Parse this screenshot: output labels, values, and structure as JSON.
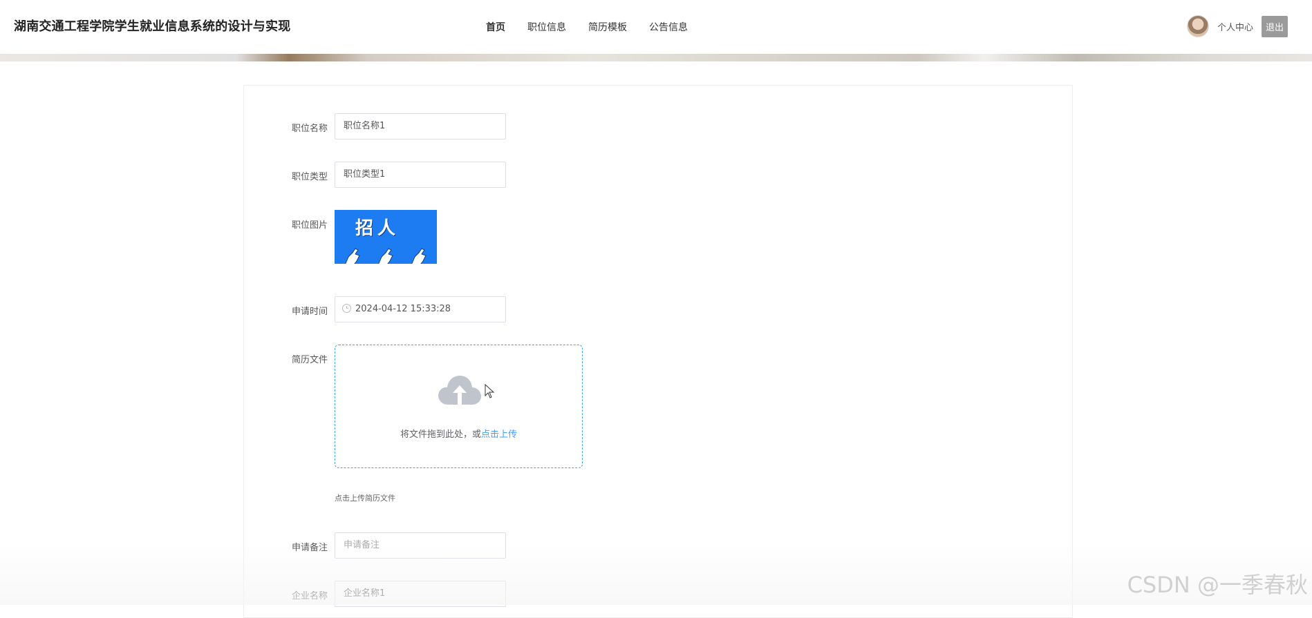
{
  "header": {
    "site_title": "湖南交通工程学院学生就业信息系统的设计与实现",
    "nav": [
      "首页",
      "职位信息",
      "简历模板",
      "公告信息"
    ],
    "user_center": "个人中心",
    "logout": "退出"
  },
  "form": {
    "position_name": {
      "label": "职位名称",
      "value": "职位名称1"
    },
    "position_type": {
      "label": "职位类型",
      "value": "职位类型1"
    },
    "position_image": {
      "label": "职位图片",
      "image_text": "招人"
    },
    "apply_time": {
      "label": "申请时间",
      "value": "2024-04-12 15:33:28"
    },
    "resume_file": {
      "label": "简历文件",
      "drop_text": "将文件拖到此处，或",
      "upload_link": "点击上传",
      "hint": "点击上传简历文件"
    },
    "apply_note": {
      "label": "申请备注",
      "placeholder": "申请备注"
    },
    "company_name": {
      "label": "企业名称",
      "value": "企业名称1"
    }
  },
  "watermark": "CSDN @一季春秋",
  "colors": {
    "accent": "#409eff",
    "image_bg": "#1e7cf2",
    "logout_bg": "#9a9a9a"
  }
}
